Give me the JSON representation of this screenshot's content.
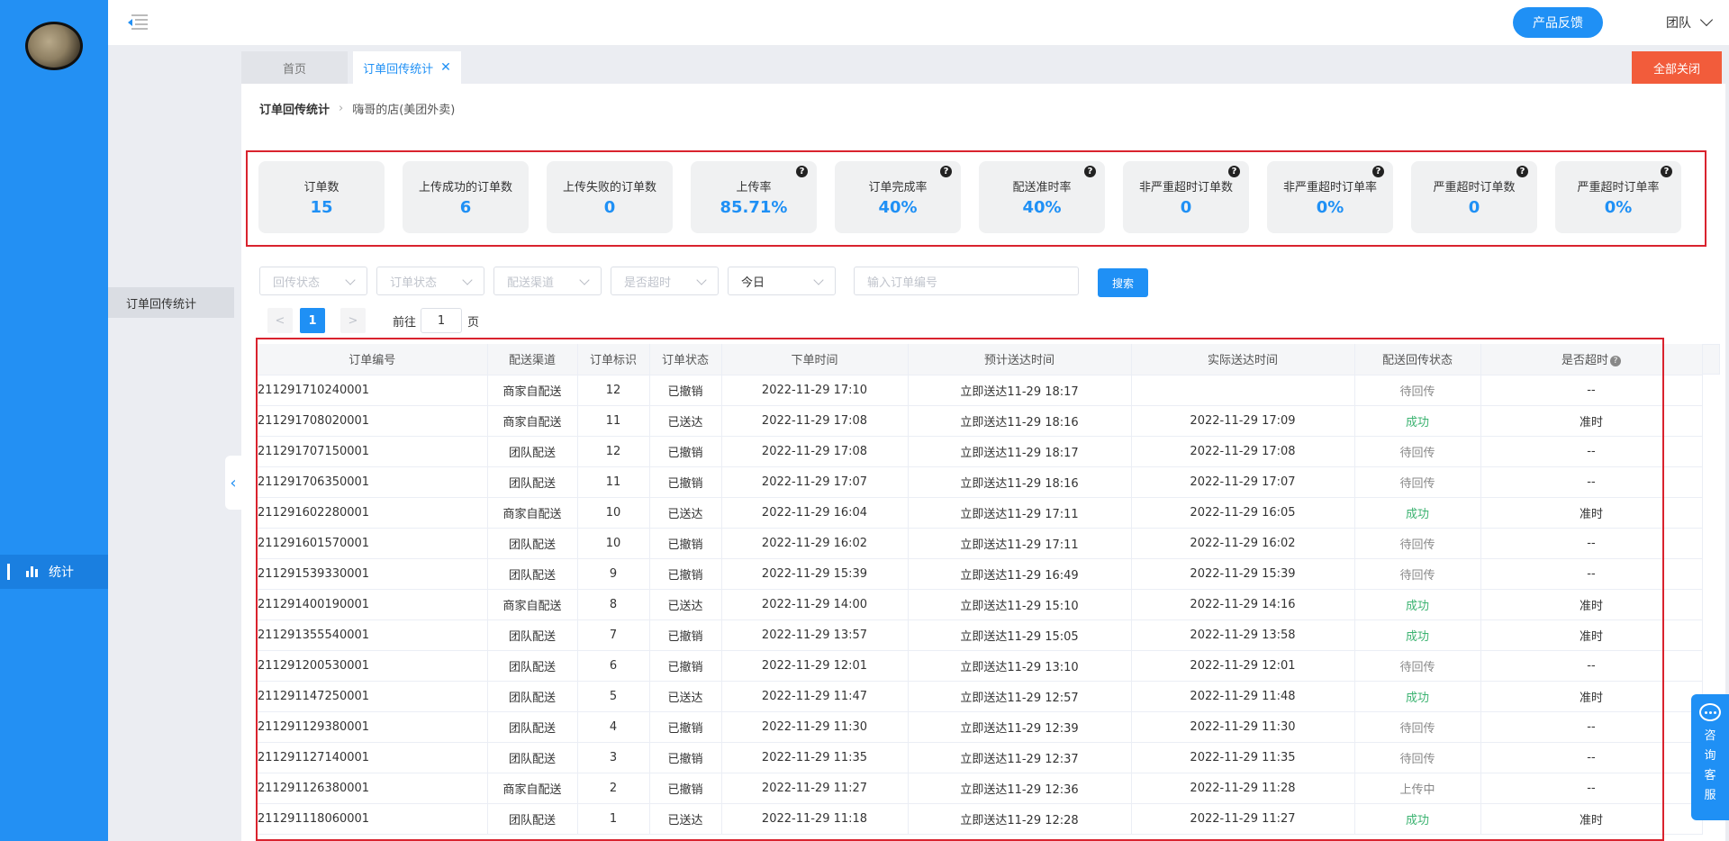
{
  "header": {
    "feedback_label": "产品反馈",
    "team_label": "团队"
  },
  "sidebar": {
    "stat_label": "统计"
  },
  "subside": {
    "item_label": "订单回传统计"
  },
  "tabs": {
    "home_label": "首页",
    "active_label": "订单回传统计",
    "close_all_label": "全部关闭"
  },
  "breadcrumb": {
    "title": "订单回传统计",
    "store": "嗨哥的店(美团外卖)"
  },
  "stats": [
    {
      "label": "订单数",
      "value": "15",
      "help": false
    },
    {
      "label": "上传成功的订单数",
      "value": "6",
      "help": false
    },
    {
      "label": "上传失败的订单数",
      "value": "0",
      "help": false
    },
    {
      "label": "上传率",
      "value": "85.71%",
      "help": true
    },
    {
      "label": "订单完成率",
      "value": "40%",
      "help": true
    },
    {
      "label": "配送准时率",
      "value": "40%",
      "help": true
    },
    {
      "label": "非严重超时订单数",
      "value": "0",
      "help": true
    },
    {
      "label": "非严重超时订单率",
      "value": "0%",
      "help": true
    },
    {
      "label": "严重超时订单数",
      "value": "0",
      "help": true
    },
    {
      "label": "严重超时订单率",
      "value": "0%",
      "help": true
    }
  ],
  "filters": {
    "upload_status_placeholder": "回传状态",
    "order_status_placeholder": "订单状态",
    "channel_placeholder": "配送渠道",
    "timeout_placeholder": "是否超时",
    "date_value": "今日",
    "order_no_placeholder": "输入订单编号",
    "search_label": "搜索"
  },
  "pagination": {
    "prev": "<",
    "current": "1",
    "next": ">",
    "goto_label": "前往",
    "goto_value": "1",
    "page_label": "页"
  },
  "table": {
    "headers": [
      "订单编号",
      "配送渠道",
      "订单标识",
      "订单状态",
      "下单时间",
      "预计送达时间",
      "实际送达时间",
      "配送回传状态",
      "是否超时"
    ],
    "rows": [
      [
        "211291710240001",
        "商家自配送",
        "12",
        "已撤销",
        "2022-11-29 17:10",
        "立即送达11-29 18:17",
        "",
        "待回传",
        "--"
      ],
      [
        "211291708020001",
        "商家自配送",
        "11",
        "已送达",
        "2022-11-29 17:08",
        "立即送达11-29 18:16",
        "2022-11-29 17:09",
        "成功",
        "准时"
      ],
      [
        "211291707150001",
        "团队配送",
        "12",
        "已撤销",
        "2022-11-29 17:08",
        "立即送达11-29 18:17",
        "2022-11-29 17:08",
        "待回传",
        "--"
      ],
      [
        "211291706350001",
        "团队配送",
        "11",
        "已撤销",
        "2022-11-29 17:07",
        "立即送达11-29 18:16",
        "2022-11-29 17:07",
        "待回传",
        "--"
      ],
      [
        "211291602280001",
        "商家自配送",
        "10",
        "已送达",
        "2022-11-29 16:04",
        "立即送达11-29 17:11",
        "2022-11-29 16:05",
        "成功",
        "准时"
      ],
      [
        "211291601570001",
        "团队配送",
        "10",
        "已撤销",
        "2022-11-29 16:02",
        "立即送达11-29 17:11",
        "2022-11-29 16:02",
        "待回传",
        "--"
      ],
      [
        "211291539330001",
        "团队配送",
        "9",
        "已撤销",
        "2022-11-29 15:39",
        "立即送达11-29 16:49",
        "2022-11-29 15:39",
        "待回传",
        "--"
      ],
      [
        "211291400190001",
        "商家自配送",
        "8",
        "已送达",
        "2022-11-29 14:00",
        "立即送达11-29 15:10",
        "2022-11-29 14:16",
        "成功",
        "准时"
      ],
      [
        "211291355540001",
        "团队配送",
        "7",
        "已撤销",
        "2022-11-29 13:57",
        "立即送达11-29 15:05",
        "2022-11-29 13:58",
        "成功",
        "准时"
      ],
      [
        "211291200530001",
        "团队配送",
        "6",
        "已撤销",
        "2022-11-29 12:01",
        "立即送达11-29 13:10",
        "2022-11-29 12:01",
        "待回传",
        "--"
      ],
      [
        "211291147250001",
        "团队配送",
        "5",
        "已送达",
        "2022-11-29 11:47",
        "立即送达11-29 12:57",
        "2022-11-29 11:48",
        "成功",
        "准时"
      ],
      [
        "211291129380001",
        "团队配送",
        "4",
        "已撤销",
        "2022-11-29 11:30",
        "立即送达11-29 12:39",
        "2022-11-29 11:30",
        "待回传",
        "--"
      ],
      [
        "211291127140001",
        "团队配送",
        "3",
        "已撤销",
        "2022-11-29 11:35",
        "立即送达11-29 12:37",
        "2022-11-29 11:35",
        "待回传",
        "--"
      ],
      [
        "211291126380001",
        "商家自配送",
        "2",
        "已撤销",
        "2022-11-29 11:27",
        "立即送达11-29 12:36",
        "2022-11-29 11:28",
        "上传中",
        "--"
      ],
      [
        "211291118060001",
        "团队配送",
        "1",
        "已送达",
        "2022-11-29 11:18",
        "立即送达11-29 12:28",
        "2022-11-29 11:27",
        "成功",
        "准时"
      ]
    ]
  },
  "customer_service": {
    "label": "咨询客服"
  },
  "colors": {
    "primary": "#1f90f5",
    "sidebar": "#2390f3",
    "danger": "#f25c3b",
    "highlight_border": "#d9232e",
    "success": "#3cb371"
  }
}
